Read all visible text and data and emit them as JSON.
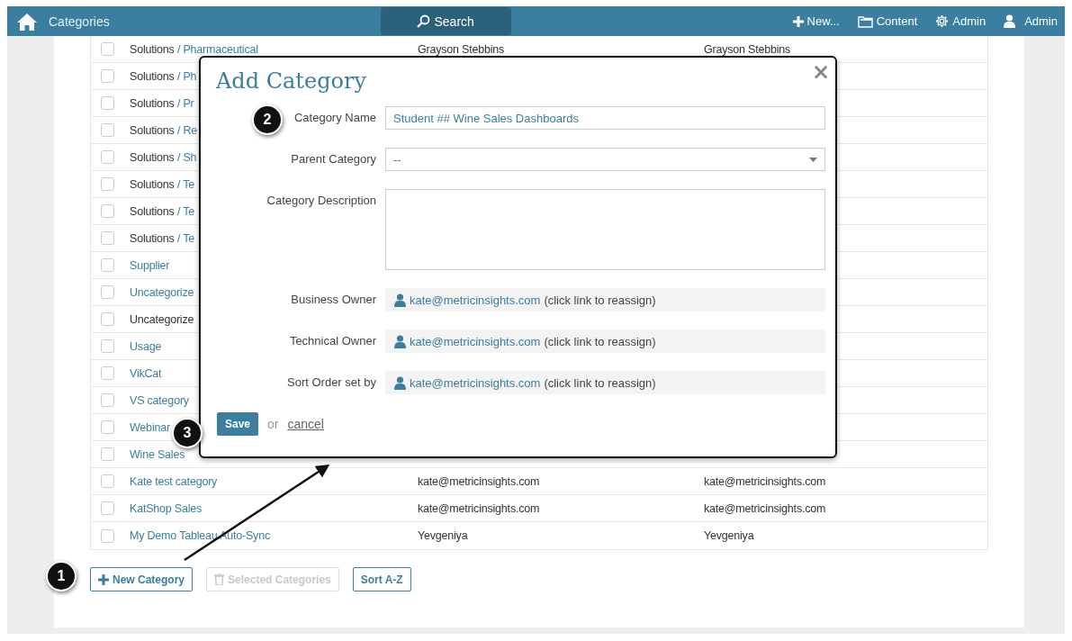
{
  "nav": {
    "title": "Categories",
    "search": "Search",
    "items": [
      {
        "kind": "plus",
        "label": "New..."
      },
      {
        "kind": "folder",
        "label": "Content"
      },
      {
        "kind": "gear",
        "label": "Admin"
      },
      {
        "kind": "user",
        "label": "Admin"
      }
    ]
  },
  "table": {
    "rows": [
      {
        "checked": false,
        "parent": "Solutions",
        "name": "/ Pharmaceutical",
        "column_2": "Grayson Stebbins",
        "column_3": "Grayson Stebbins"
      },
      {
        "checked": false,
        "parent": "Solutions",
        "name": "/ Ph"
      },
      {
        "checked": false,
        "parent": "Solutions",
        "name": "/ Pr"
      },
      {
        "checked": false,
        "parent": "Solutions",
        "name": "/ Re"
      },
      {
        "checked": false,
        "parent": "Solutions",
        "name": "/ Sh"
      },
      {
        "checked": false,
        "parent": "Solutions",
        "name": "/ Te"
      },
      {
        "checked": false,
        "parent": "Solutions",
        "name": "/ Te"
      },
      {
        "checked": false,
        "parent": "Solutions",
        "name": "/ Te"
      },
      {
        "checked": false,
        "name": "Supplier"
      },
      {
        "checked": false,
        "name": "Uncategorize"
      },
      {
        "checked": false,
        "parent": "Uncategorize"
      },
      {
        "checked": false,
        "name": "Usage"
      },
      {
        "checked": false,
        "name": "VikCat"
      },
      {
        "checked": false,
        "name": "VS category"
      },
      {
        "checked": false,
        "name": "Webinar"
      },
      {
        "checked": false,
        "name": "Wine Sales"
      },
      {
        "checked": false,
        "name": "Kate test category",
        "column_2": "kate@metricinsights.com",
        "column_3": "kate@metricinsights.com"
      },
      {
        "checked": false,
        "name": "KatShop Sales",
        "column_2": "kate@metricinsights.com",
        "column_3": "kate@metricinsights.com"
      },
      {
        "checked": false,
        "name": "My Demo Tableau Auto-Sync",
        "column_2": "Yevgeniya",
        "column_3": "Yevgeniya"
      }
    ]
  },
  "buttons": [
    {
      "kind": "plus",
      "label": "New Category",
      "disabled": false
    },
    {
      "kind": "trash",
      "label": "Selected Categories",
      "disabled": true
    },
    {
      "kind": "none",
      "label": "Sort A-Z",
      "disabled": false
    }
  ],
  "dialog": {
    "title": "Add Category",
    "close": "×",
    "category_name": {
      "label": "Category Name",
      "value": "Student ## Wine Sales Dashboards"
    },
    "parent_category": {
      "label": "Parent Category",
      "value": "--"
    },
    "description": {
      "label": "Category Description"
    },
    "owners": [
      {
        "label": "Business Owner",
        "user": "kate@metricinsights.com",
        "note": "(click link to reassign)"
      },
      {
        "label": "Technical Owner",
        "user": "kate@metricinsights.com",
        "note": "(click link to reassign)"
      },
      {
        "label": "Sort Order set by",
        "user": "kate@metricinsights.com",
        "note": "(click link to reassign)"
      }
    ],
    "save": "Save",
    "or": "or",
    "cancel": "cancel"
  },
  "callouts": [
    "1",
    "2",
    "3"
  ]
}
